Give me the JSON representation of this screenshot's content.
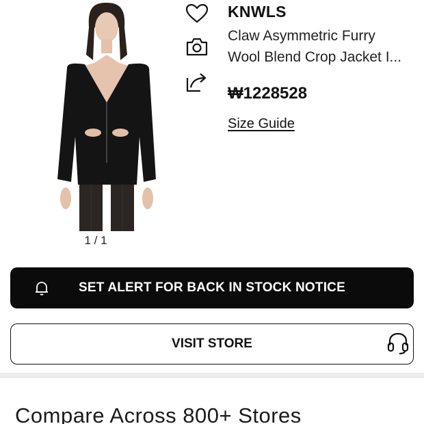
{
  "product": {
    "image_alt": "model wearing black furry cropped jacket",
    "image_counter": "1 / 1",
    "brand": "KNWLS",
    "name_line1": "Claw Asymmetric Furry",
    "name_line2": "Wool Blend Crop Jacket I...",
    "price": "₩1228528",
    "size_guide": "Size Guide"
  },
  "actions": {
    "wishlist_icon": "heart-icon",
    "camera_icon": "camera-icon",
    "share_icon": "share-icon"
  },
  "buttons": {
    "alert_label": "SET ALERT FOR BACK IN STOCK NOTICE",
    "alert_icon": "bell-icon",
    "visit_label": "VISIT STORE",
    "support_icon": "headset-icon"
  },
  "compare": {
    "title": "Compare Across 800+ Stores"
  },
  "colors": {
    "primary_button_bg": "#0b0b0b",
    "divider": "#ececec"
  }
}
